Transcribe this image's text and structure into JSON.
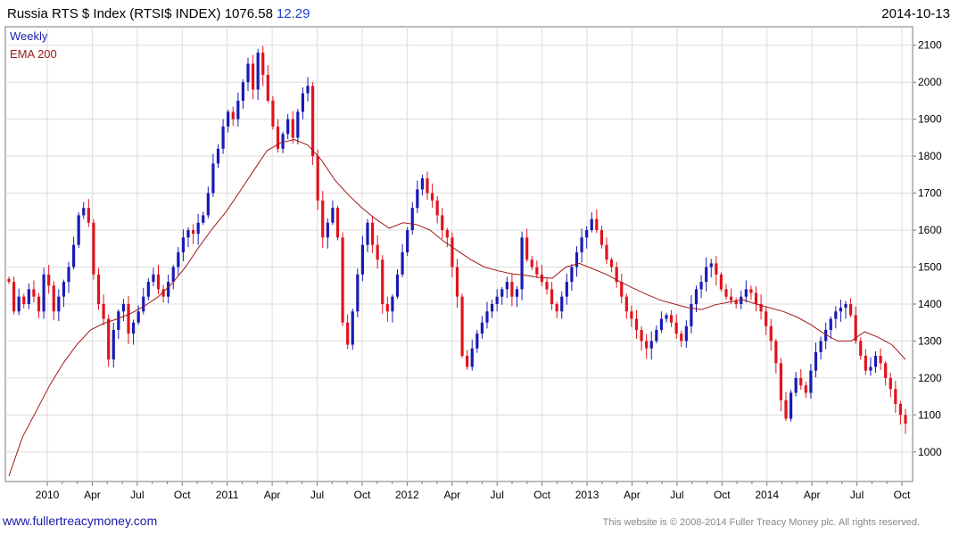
{
  "header": {
    "title": "Russia RTS $ Index (RTSI$ INDEX) 1076.58",
    "change": "12.29",
    "date": "2014-10-13"
  },
  "footer": {
    "website": "www.fullertreacymoney.com",
    "copyright": "This website is © 2008-2014 Fuller Treacy Money plc. All rights reserved."
  },
  "colors": {
    "up": "#1a1ab4",
    "down": "#e0141e",
    "ema": "#a01818",
    "grid": "#dcdcdc",
    "frame": "#7a7a7a"
  },
  "chart_data": {
    "type": "line",
    "frequency_label": "Weekly",
    "indicator_label": "EMA 200",
    "x_ticks": [
      "2010",
      "Apr",
      "Jul",
      "Oct",
      "2011",
      "Apr",
      "Jul",
      "Oct",
      "2012",
      "Apr",
      "Jul",
      "Oct",
      "2013",
      "Apr",
      "Jul",
      "Oct",
      "2014",
      "Apr",
      "Jul",
      "Oct"
    ],
    "y_ticks": [
      1000,
      1100,
      1200,
      1300,
      1400,
      1500,
      1600,
      1700,
      1800,
      1900,
      2000,
      2100
    ],
    "ylim": [
      920,
      2150
    ],
    "grid": true,
    "series": [
      {
        "name": "RTSI$ INDEX",
        "kind": "candlestick",
        "close": [
          1460,
          1380,
          1420,
          1400,
          1440,
          1420,
          1380,
          1480,
          1450,
          1380,
          1420,
          1460,
          1500,
          1560,
          1640,
          1660,
          1620,
          1480,
          1400,
          1360,
          1250,
          1330,
          1380,
          1400,
          1320,
          1350,
          1380,
          1420,
          1460,
          1480,
          1440,
          1420,
          1460,
          1500,
          1540,
          1580,
          1600,
          1590,
          1620,
          1640,
          1700,
          1780,
          1820,
          1880,
          1920,
          1900,
          1950,
          2000,
          2050,
          1980,
          2080,
          2020,
          1950,
          1880,
          1820,
          1860,
          1900,
          1850,
          1920,
          1970,
          1990,
          1800,
          1680,
          1580,
          1620,
          1660,
          1580,
          1350,
          1290,
          1380,
          1480,
          1560,
          1620,
          1560,
          1520,
          1400,
          1380,
          1420,
          1480,
          1540,
          1600,
          1660,
          1710,
          1740,
          1700,
          1680,
          1640,
          1600,
          1580,
          1500,
          1420,
          1260,
          1230,
          1280,
          1320,
          1350,
          1380,
          1400,
          1420,
          1440,
          1460,
          1420,
          1440,
          1580,
          1520,
          1500,
          1480,
          1460,
          1440,
          1400,
          1380,
          1420,
          1460,
          1500,
          1540,
          1580,
          1600,
          1630,
          1600,
          1560,
          1520,
          1500,
          1460,
          1420,
          1380,
          1360,
          1330,
          1300,
          1280,
          1300,
          1330,
          1360,
          1370,
          1350,
          1320,
          1300,
          1340,
          1400,
          1440,
          1460,
          1500,
          1510,
          1480,
          1440,
          1420,
          1410,
          1400,
          1420,
          1440,
          1430,
          1400,
          1380,
          1340,
          1300,
          1240,
          1140,
          1090,
          1160,
          1200,
          1180,
          1160,
          1220,
          1270,
          1300,
          1330,
          1360,
          1380,
          1390,
          1400,
          1370,
          1300,
          1260,
          1220,
          1230,
          1260,
          1240,
          1200,
          1170,
          1130,
          1100,
          1076.58
        ]
      },
      {
        "name": "EMA 200",
        "kind": "line",
        "values": [
          935,
          1040,
          1110,
          1180,
          1240,
          1290,
          1330,
          1348,
          1360,
          1375,
          1395,
          1420,
          1455,
          1500,
          1555,
          1605,
          1650,
          1705,
          1760,
          1815,
          1836,
          1845,
          1830,
          1790,
          1735,
          1695,
          1660,
          1630,
          1605,
          1620,
          1615,
          1600,
          1570,
          1545,
          1520,
          1500,
          1490,
          1482,
          1478,
          1472,
          1470,
          1500,
          1510,
          1495,
          1480,
          1460,
          1442,
          1425,
          1410,
          1400,
          1390,
          1385,
          1398,
          1405,
          1412,
          1400,
          1390,
          1380,
          1365,
          1345,
          1320,
          1300,
          1300,
          1325,
          1310,
          1290,
          1250
        ]
      }
    ]
  }
}
